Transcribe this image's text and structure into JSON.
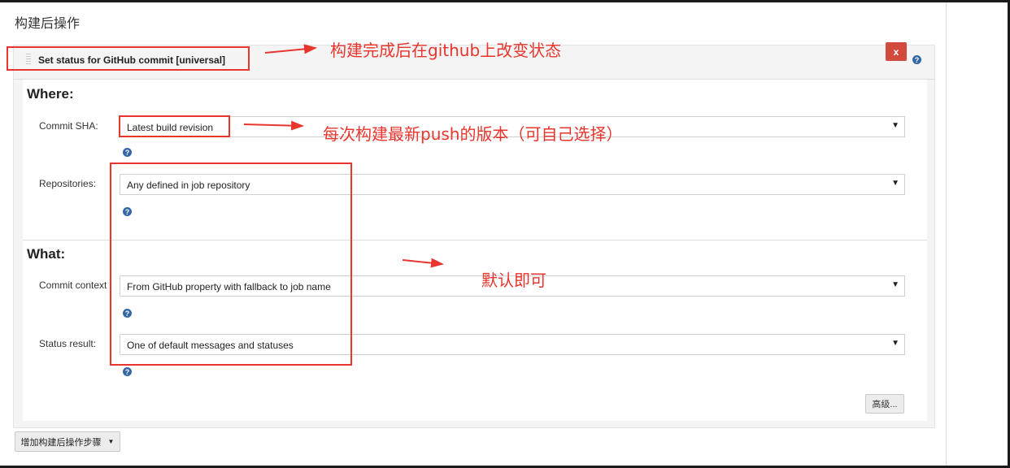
{
  "section_title": "构建后操作",
  "step": {
    "title": "Set status for GitHub commit [universal]",
    "delete_label": "x"
  },
  "where": {
    "heading": "Where:",
    "commit_sha": {
      "label": "Commit SHA:",
      "value": "Latest build revision"
    },
    "repositories": {
      "label": "Repositories:",
      "value": "Any defined in job repository"
    }
  },
  "what": {
    "heading": "What:",
    "commit_context": {
      "label": "Commit context",
      "value": "From GitHub property with fallback to job name"
    },
    "status_result": {
      "label": "Status result:",
      "value": "One of default messages and statuses"
    }
  },
  "buttons": {
    "advanced": "高级...",
    "add_post_build": "增加构建后操作步骤"
  },
  "help_glyph": "?",
  "annotations": {
    "status_note": "构建完成后在github上改变状态",
    "sha_note": "每次构建最新push的版本（可自己选择）",
    "default_note": "默认即可"
  },
  "colors": {
    "annotation_red": "#e8352d",
    "delete_red": "#d24a3c",
    "help_blue": "#3566a8"
  },
  "icons": {
    "delete": "close-icon",
    "help": "help-icon",
    "dropdown": "caret-down-icon",
    "drag": "drag-handle-icon"
  }
}
